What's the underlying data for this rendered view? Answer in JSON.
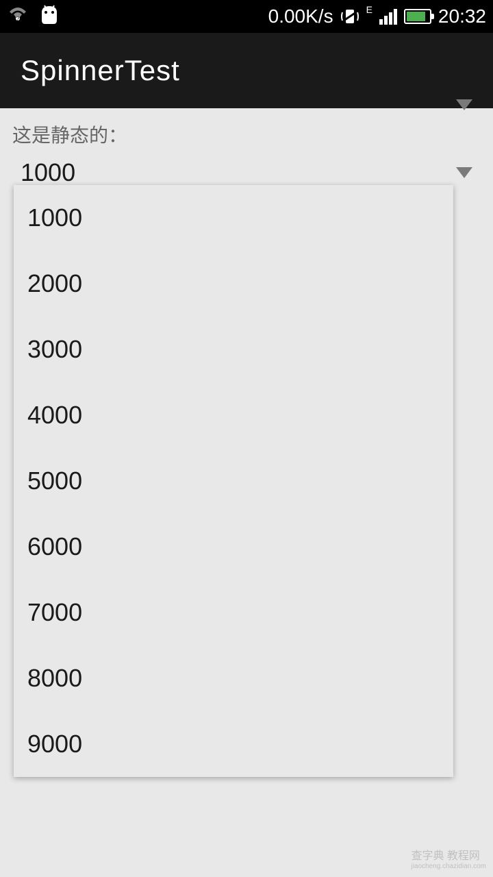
{
  "status": {
    "speed": "0.00K/s",
    "time": "20:32",
    "network_type": "E"
  },
  "app": {
    "title": "SpinnerTest"
  },
  "content": {
    "label": "这是静态的：",
    "selected_value": "1000"
  },
  "dropdown": {
    "items": [
      "1000",
      "2000",
      "3000",
      "4000",
      "5000",
      "6000",
      "7000",
      "8000",
      "9000"
    ]
  },
  "watermark": {
    "main": "查字典  教程网",
    "sub": "jiaocheng.chazidian.com"
  }
}
